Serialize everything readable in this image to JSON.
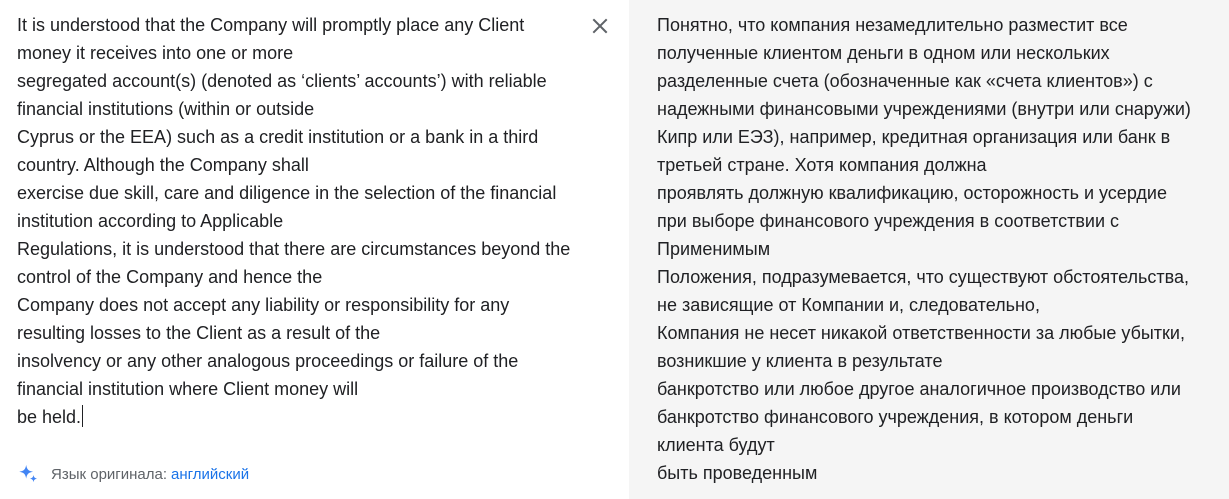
{
  "source": {
    "lines": [
      "It is understood that the Company will promptly place any Client",
      "money it receives into one or more",
      "segregated account(s) (denoted as ‘clients’ accounts’) with reliable",
      "financial institutions (within or outside",
      "Cyprus or the EEA) such as a credit institution or a bank in a third",
      "country. Although the Company shall",
      "exercise due skill, care and diligence in the selection of the financial",
      "institution according to Applicable",
      "Regulations, it is understood that there are circumstances beyond the",
      "control of the Company and hence the",
      "Company does not accept any liability or responsibility for any",
      "resulting losses to the Client as a result of the",
      "insolvency or any other analogous proceedings or failure of the",
      "financial institution where Client money will",
      "be held."
    ],
    "close_icon": "close-icon",
    "footer": {
      "icon": "sparkle-icon",
      "label": "Язык оригинала:",
      "language": "английский"
    }
  },
  "target": {
    "lines": [
      "Понятно, что компания незамедлительно разместит все",
      "полученные клиентом деньги в одном или нескольких",
      "разделенные счета (обозначенные как «счета клиентов») с",
      "надежными финансовыми учреждениями (внутри или снаружи)",
      "Кипр или ЕЭЗ), например, кредитная организация или банк в",
      "третьей стране. Хотя компания должна",
      "проявлять должную квалификацию, осторожность и усердие",
      "при выборе финансового учреждения в соответствии с",
      "Применимым",
      "Положения, подразумевается, что существуют обстоятельства,",
      "не зависящие от Компании и, следовательно,",
      "Компания не несет никакой ответственности за любые убытки,",
      "возникшие у клиента в результате",
      "банкротство или любое другое аналогичное производство или",
      "банкротство финансового учреждения, в котором деньги",
      "клиента будут",
      "быть проведенным"
    ]
  },
  "colors": {
    "text": "#202124",
    "muted": "#5f6368",
    "link": "#1a73e8",
    "target_bg": "#f5f5f5",
    "sparkle": "#4285f4"
  }
}
